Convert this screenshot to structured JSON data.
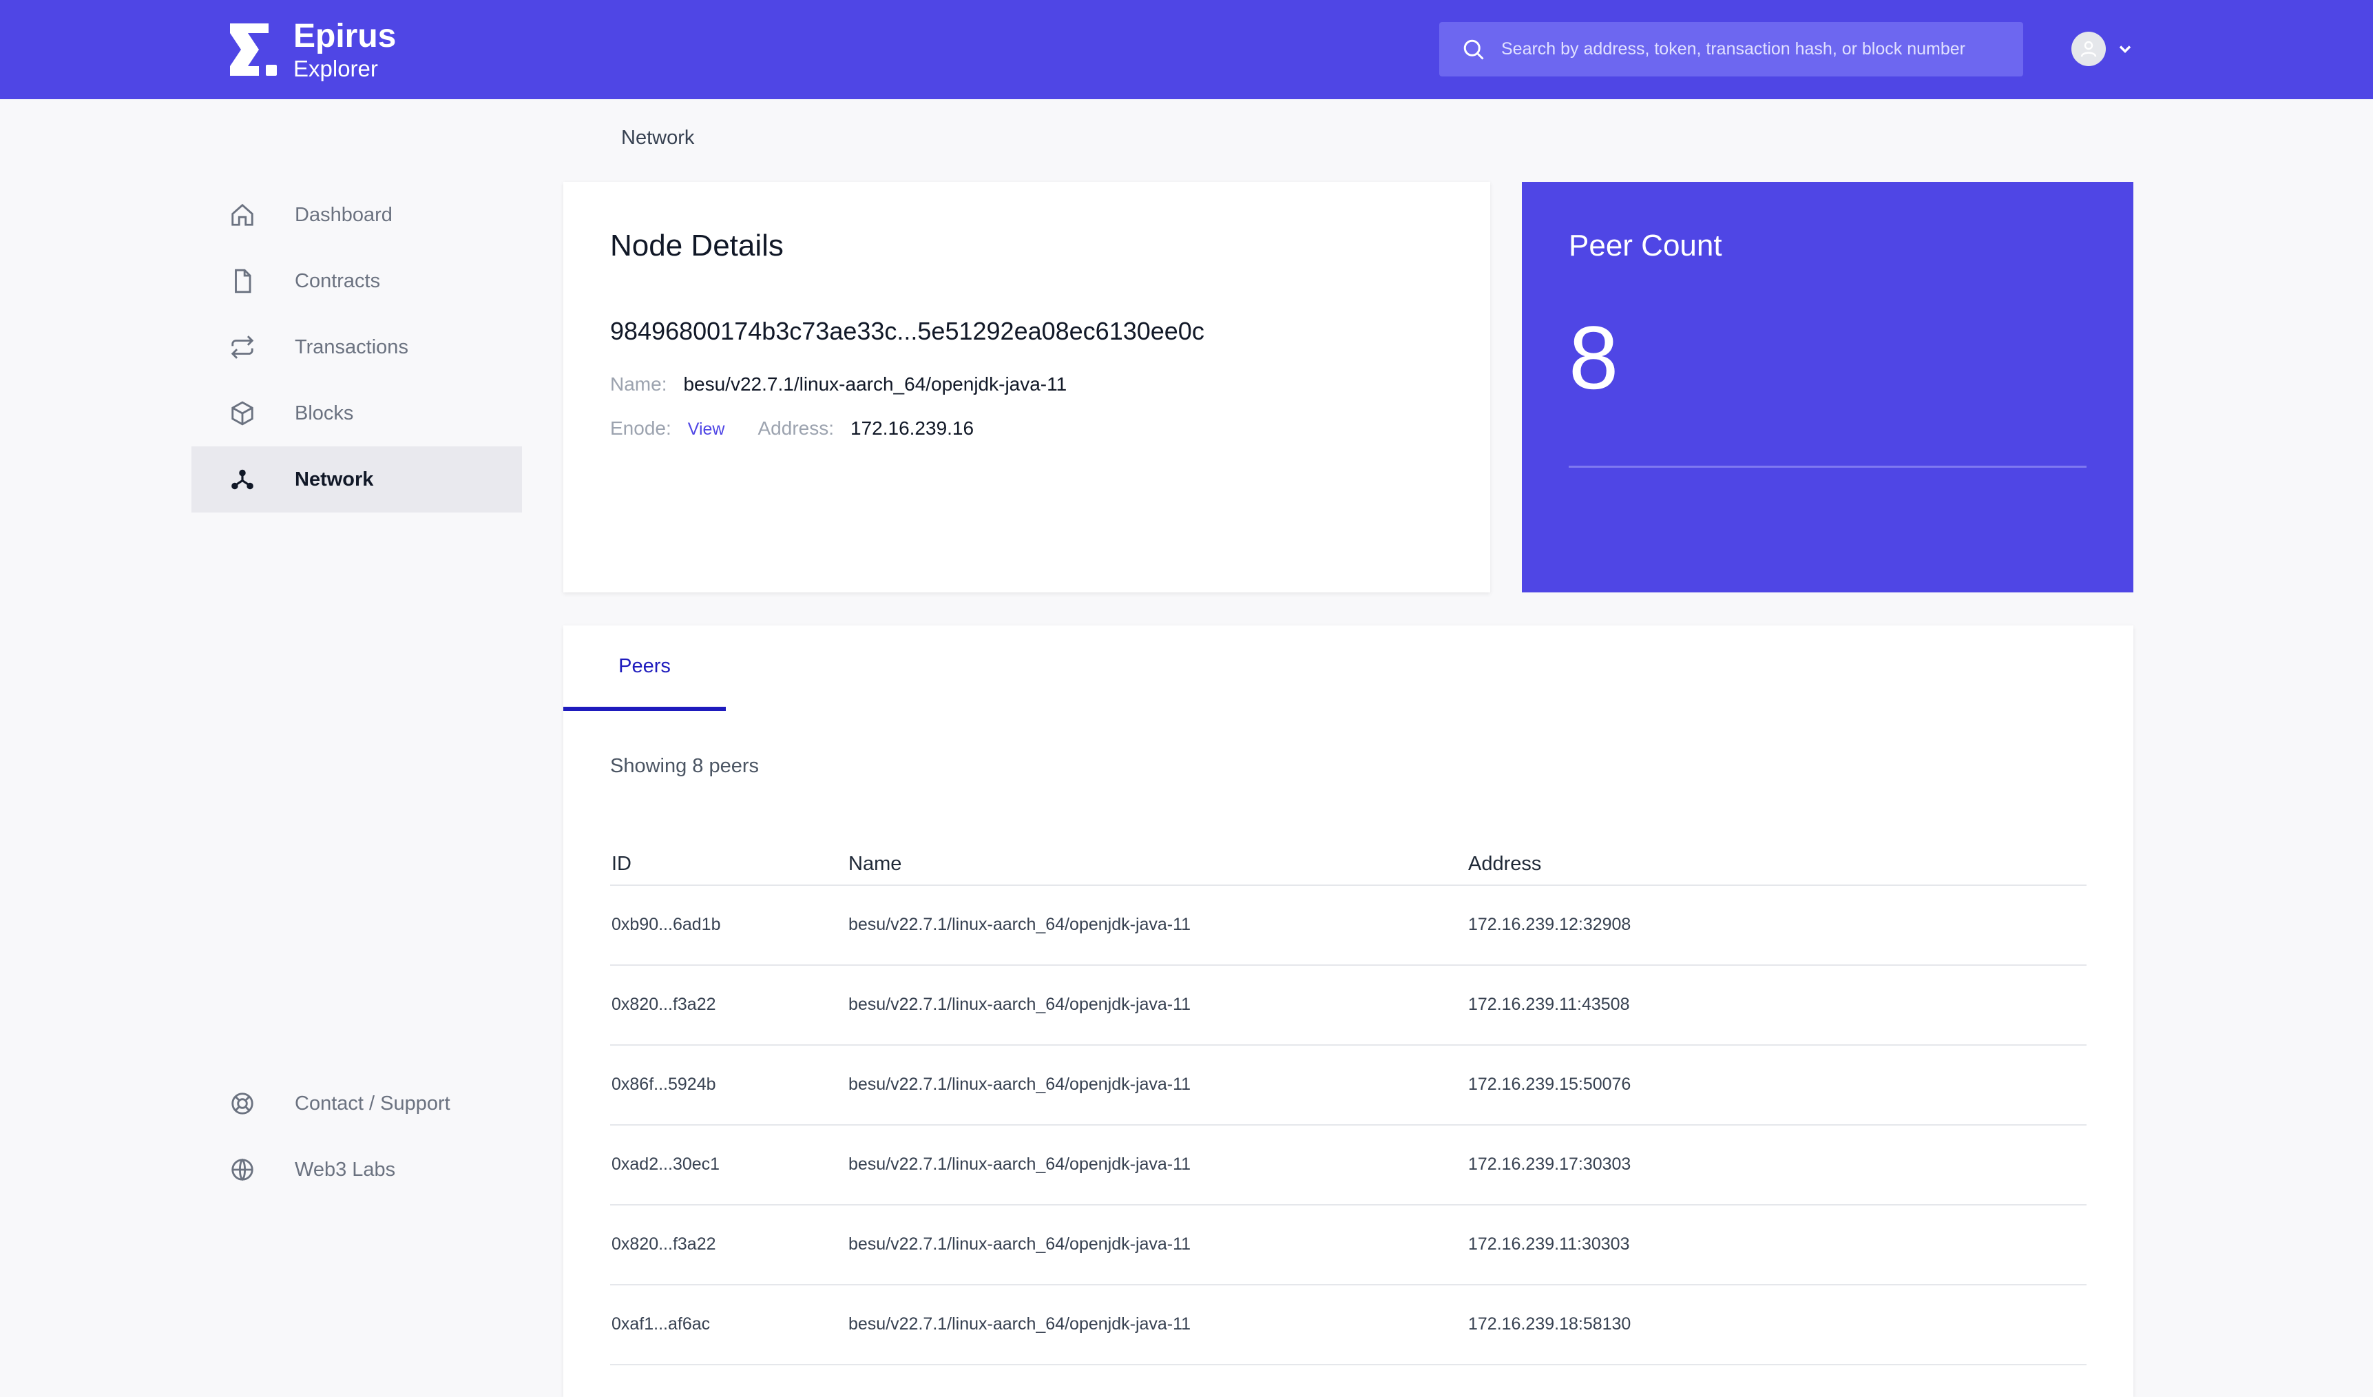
{
  "header": {
    "brand_title": "Epirus",
    "brand_subtitle": "Explorer",
    "search_placeholder": "Search by address, token, transaction hash, or block number",
    "brand_color": "#4f46e5"
  },
  "sidebar": {
    "items": [
      {
        "label": "Dashboard",
        "icon": "home-icon"
      },
      {
        "label": "Contracts",
        "icon": "document-icon"
      },
      {
        "label": "Transactions",
        "icon": "arrows-exchange-icon"
      },
      {
        "label": "Blocks",
        "icon": "cube-icon"
      },
      {
        "label": "Network",
        "icon": "network-icon",
        "active": true
      }
    ],
    "footer_items": [
      {
        "label": "Contact / Support",
        "icon": "lifebuoy-icon"
      },
      {
        "label": "Web3 Labs",
        "icon": "globe-icon"
      }
    ]
  },
  "page": {
    "heading": "Network"
  },
  "node_details": {
    "title": "Node Details",
    "id": "98496800174b3c73ae33c...5e51292ea08ec6130ee0c",
    "name_label": "Name:",
    "name_value": "besu/v22.7.1/linux-aarch_64/openjdk-java-11",
    "enode_label": "Enode:",
    "enode_link": "View",
    "address_label": "Address:",
    "address_value": "172.16.239.16"
  },
  "peer_count": {
    "title": "Peer Count",
    "value": "8"
  },
  "peers": {
    "tab_label": "Peers",
    "showing_text": "Showing 8 peers",
    "columns": [
      "ID",
      "Name",
      "Address"
    ],
    "rows": [
      {
        "id": "0xb90...6ad1b",
        "name": "besu/v22.7.1/linux-aarch_64/openjdk-java-11",
        "address": "172.16.239.12:32908"
      },
      {
        "id": "0x820...f3a22",
        "name": "besu/v22.7.1/linux-aarch_64/openjdk-java-11",
        "address": "172.16.239.11:43508"
      },
      {
        "id": "0x86f...5924b",
        "name": "besu/v22.7.1/linux-aarch_64/openjdk-java-11",
        "address": "172.16.239.15:50076"
      },
      {
        "id": "0xad2...30ec1",
        "name": "besu/v22.7.1/linux-aarch_64/openjdk-java-11",
        "address": "172.16.239.17:30303"
      },
      {
        "id": "0x820...f3a22",
        "name": "besu/v22.7.1/linux-aarch_64/openjdk-java-11",
        "address": "172.16.239.11:30303"
      },
      {
        "id": "0xaf1...af6ac",
        "name": "besu/v22.7.1/linux-aarch_64/openjdk-java-11",
        "address": "172.16.239.18:58130"
      }
    ]
  }
}
